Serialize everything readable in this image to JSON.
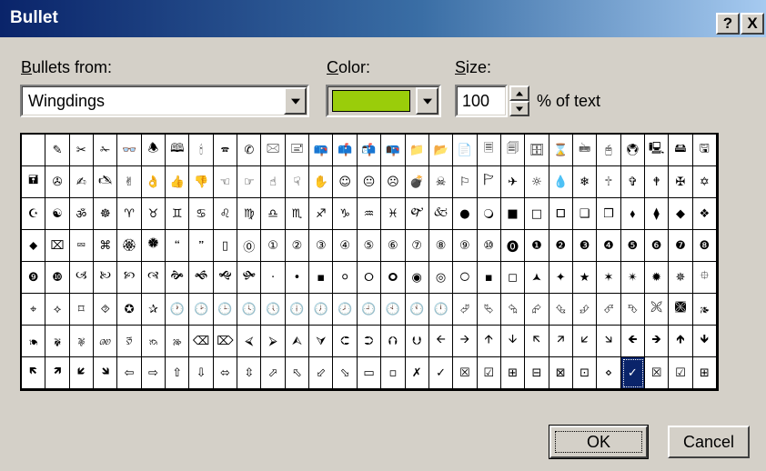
{
  "window": {
    "title": "Bullet"
  },
  "titlebar_buttons": {
    "help": "?",
    "close": "X"
  },
  "bullets_from": {
    "label_access": "B",
    "label_rest": "ullets from:",
    "value": "Wingdings"
  },
  "color": {
    "label_access": "C",
    "label_rest": "olor:",
    "swatch": "#9acd0a"
  },
  "size": {
    "label_access": "S",
    "label_rest": "ize:",
    "value": "100",
    "suffix": "% of text"
  },
  "grid": {
    "selected_row": 7,
    "selected_col": 25,
    "rows": [
      [
        " ",
        "✎",
        "✂",
        "✁",
        "👓",
        "🕭",
        "🕮",
        "🕯",
        "🕿",
        "✆",
        "🖂",
        "🖃",
        "📪",
        "📫",
        "📬",
        "📭",
        "📁",
        "📂",
        "📄",
        "🗏",
        "🗐",
        "🗄",
        "⌛",
        "🖮",
        "🖰",
        "🖲",
        "🖳",
        "🖴",
        "🖫"
      ],
      [
        "🖬",
        "✇",
        "✍",
        "🖎",
        "✌",
        "👌",
        "👍",
        "👎",
        "☜",
        "☞",
        "☝",
        "☟",
        "✋",
        "☺",
        "😐",
        "☹",
        "💣",
        "☠",
        "⚐",
        "🏱",
        "✈",
        "☼",
        "💧",
        "❄",
        "🕆",
        "✞",
        "🕈",
        "✠",
        "✡"
      ],
      [
        "☪",
        "☯",
        "ॐ",
        "☸",
        "♈",
        "♉",
        "♊",
        "♋",
        "♌",
        "♍",
        "♎",
        "♏",
        "♐",
        "♑",
        "♒",
        "♓",
        "🙰",
        "🙵",
        "●",
        "🔾",
        "■",
        "□",
        "🞐",
        "❑",
        "❒",
        "⬧",
        "⧫",
        "◆",
        "❖"
      ],
      [
        "⬥",
        "⌧",
        "⮹",
        "⌘",
        "🏵",
        "🏶",
        "🙶",
        "🙷",
        "▯",
        "⓪",
        "①",
        "②",
        "③",
        "④",
        "⑤",
        "⑥",
        "⑦",
        "⑧",
        "⑨",
        "⑩",
        "⓿",
        "❶",
        "❷",
        "❸",
        "❹",
        "❺",
        "❻",
        "❼",
        "❽"
      ],
      [
        "❾",
        "❿",
        "🙢",
        "🙠",
        "🙡",
        "🙣",
        "🙞",
        "🙜",
        "🙝",
        "🙟",
        "·",
        "•",
        "▪",
        "⚪",
        "🞆",
        "🞈",
        "◉",
        "◎",
        "🞅",
        "▪",
        "◻",
        "🟂",
        "✦",
        "★",
        "✶",
        "✴",
        "✹",
        "✵",
        "⯐"
      ],
      [
        "⌖",
        "⟡",
        "⌑",
        "⯑",
        "✪",
        "✰",
        "🕐",
        "🕑",
        "🕒",
        "🕓",
        "🕔",
        "🕕",
        "🕖",
        "🕗",
        "🕘",
        "🕙",
        "🕚",
        "🕛",
        "⮰",
        "⮱",
        "⮲",
        "⮳",
        "⮴",
        "⮵",
        "⮶",
        "⮷",
        "🙪",
        "🙫",
        "🙕"
      ],
      [
        "🙔",
        "🙗",
        "🙖",
        "🙐",
        "🙑",
        "🙒",
        "🙓",
        "⌫",
        "⌦",
        "⮘",
        "⮚",
        "⮙",
        "⮛",
        "⮈",
        "⮊",
        "⮉",
        "⮋",
        "🡨",
        "🡪",
        "🡩",
        "🡫",
        "🡬",
        "🡭",
        "🡯",
        "🡮",
        "🡸",
        "🡺",
        "🡹",
        "🡻"
      ],
      [
        "🡼",
        "🡽",
        "🡿",
        "🡾",
        "⇦",
        "⇨",
        "⇧",
        "⇩",
        "⬄",
        "⇳",
        "⬀",
        "⬁",
        "⬃",
        "⬂",
        "▭",
        "▫",
        "✗",
        "✓",
        "☒",
        "☑",
        "⊞",
        "⊟",
        "⊠",
        "⊡",
        "⋄",
        "✓",
        "☒",
        "☑",
        "⊞"
      ]
    ]
  },
  "buttons": {
    "ok": "OK",
    "cancel": "Cancel"
  }
}
